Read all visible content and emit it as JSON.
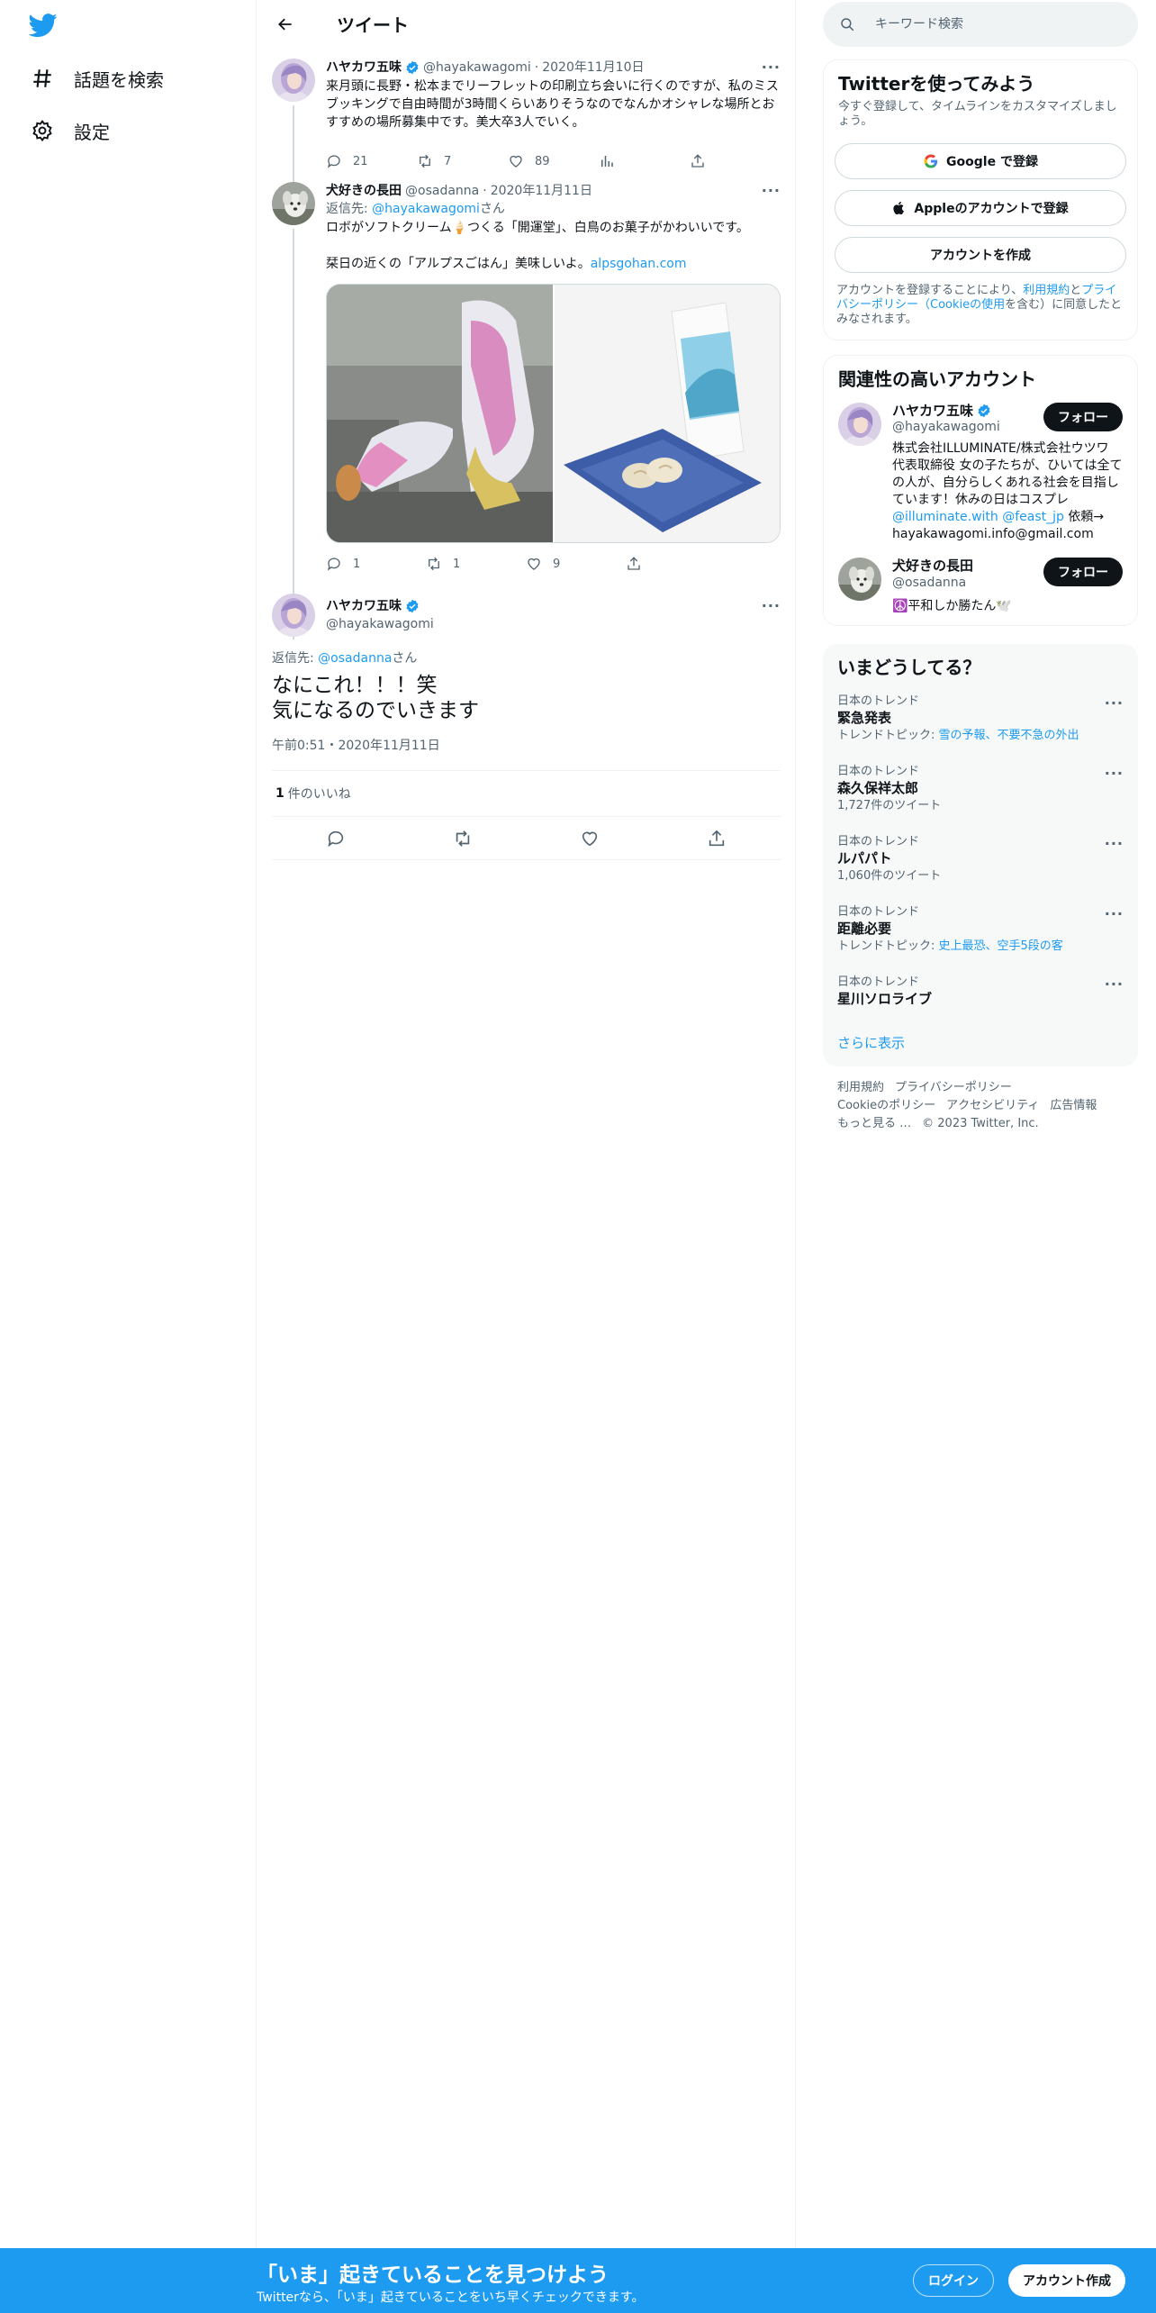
{
  "colors": {
    "accent": "#1d9bf0",
    "text": "#0f1419",
    "secondary": "#536471",
    "border": "#eff3f4"
  },
  "nav": {
    "logo_icon": "twitter-bird-icon",
    "items": [
      {
        "icon": "hashtag-icon",
        "label": "話題を検索"
      },
      {
        "icon": "gear-icon",
        "label": "設定"
      }
    ]
  },
  "header": {
    "title": "ツイート",
    "back_icon": "back-arrow-icon"
  },
  "tweets": [
    {
      "name": "ハヤカワ五味",
      "verified": true,
      "handle": "@hayakawagomi",
      "date": "2020年11月10日",
      "text": "来月頭に長野・松本までリーフレットの印刷立ち会いに行くのですが、私のミスブッキングで自由時間が3時間くらいありそうなのでなんかオシャレな場所とおすすめの場所募集中です。美大卒3人でいく。",
      "replies": "21",
      "retweets": "7",
      "likes": "89"
    },
    {
      "name": "犬好きの長田",
      "handle": "@osadanna",
      "date": "2020年11月11日",
      "reply_prefix": "返信先: ",
      "reply_to": "@hayakawagomi",
      "reply_suffix": "さん",
      "text_line1": "ロボがソフトクリーム🍦つくる「開運堂」、白鳥のお菓子がかわいいです。",
      "text_line2": "栞日の近くの「アルプスごはん」美味しいよ。",
      "link": "alpsgohan.com",
      "replies": "1",
      "retweets": "1",
      "likes": "9"
    }
  ],
  "focused": {
    "name": "ハヤカワ五味",
    "verified": true,
    "handle": "@hayakawagomi",
    "reply_prefix": "返信先: ",
    "reply_to": "@osadanna",
    "reply_suffix": "さん",
    "text_line1": "なにこれ！！！笑",
    "text_line2": "気になるのでいきます",
    "timestamp": "午前0:51・2020年11月11日",
    "likes_count": "1",
    "likes_label": "件のいいね"
  },
  "right": {
    "search_placeholder": "キーワード検索",
    "signup_card": {
      "title": "Twitterを使ってみよう",
      "subtitle": "今すぐ登録して、タイムラインをカスタマイズしましょう。",
      "google": "Google で登録",
      "apple": "Appleのアカウントで登録",
      "create": "アカウントを作成",
      "legal_1": "アカウントを登録することにより、",
      "legal_terms": "利用規約",
      "legal_and": "と",
      "legal_privacy": "プライバシーポリシー（Cookieの使用",
      "legal_2": "を含む）に同意したとみなされます。"
    },
    "related": {
      "title": "関連性の高いアカウント",
      "follow": "フォロー",
      "accounts": [
        {
          "name": "ハヤカワ五味",
          "verified": true,
          "handle": "@hayakawagomi",
          "bio_1": "株式会社ILLUMINATE/株式会社ウツワ 代表取締役 女の子たちが、ひいては全ての人が、自分らしくあれる社会を目指しています！休みの日はコスプレ ",
          "bio_link1": "@illuminate.with",
          "bio_link2": "@feast_jp",
          "bio_2": " 依頼→ hayakawagomi.info@gmail.com"
        },
        {
          "name": "犬好きの長田",
          "handle": "@osadanna",
          "bio": "☮️平和しか勝たん🕊️"
        }
      ]
    },
    "trends": {
      "title": "いまどうしてる？",
      "items": [
        {
          "category": "日本のトレンド",
          "title": "緊急発表",
          "meta_label": "トレンドトピック: ",
          "meta_link": "雪の予報、不要不急の外出"
        },
        {
          "category": "日本のトレンド",
          "title": "森久保祥太郎",
          "meta": "1,727件のツイート"
        },
        {
          "category": "日本のトレンド",
          "title": "ルパパト",
          "meta": "1,060件のツイート"
        },
        {
          "category": "日本のトレンド",
          "title": "距離必要",
          "meta_label": "トレンドトピック: ",
          "meta_link": "史上最恐、空手5段の客"
        },
        {
          "category": "日本のトレンド",
          "title": "星川ソロライブ"
        }
      ],
      "show_more": "さらに表示"
    },
    "footer": {
      "terms": "利用規約",
      "privacy": "プライバシーポリシー",
      "cookie": "Cookieのポリシー",
      "accessibility": "アクセシビリティ",
      "ads": "広告情報",
      "more": "もっと見る …",
      "copyright": "© 2023 Twitter, Inc."
    }
  },
  "bottom_bar": {
    "title": "「いま」起きていることを見つけよう",
    "subtitle": "Twitterなら、「いま」起きていることをいち早くチェックできます。",
    "login": "ログイン",
    "signup": "アカウント作成"
  }
}
